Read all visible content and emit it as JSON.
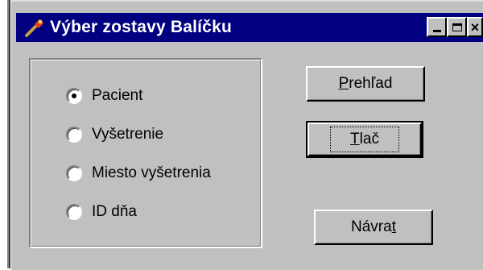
{
  "window": {
    "title": "Výber zostavy Balíčku",
    "icon": "wrench-icon",
    "controls": [
      "minimize",
      "maximize",
      "close"
    ]
  },
  "options": [
    {
      "label": "Pacient",
      "checked": true
    },
    {
      "label": "Vyšetrenie",
      "checked": false
    },
    {
      "label": "Miesto vyšetrenia",
      "checked": false
    },
    {
      "label": "ID dňa",
      "checked": false
    }
  ],
  "buttons": {
    "overview": {
      "pre": "",
      "mnemonic": "P",
      "post": "rehľad"
    },
    "print": {
      "pre": "",
      "mnemonic": "T",
      "post": "lač"
    },
    "back": {
      "pre": "Návra",
      "mnemonic": "t",
      "post": ""
    }
  },
  "colors": {
    "titlebar": "#000080",
    "face": "#c0c0c0"
  }
}
